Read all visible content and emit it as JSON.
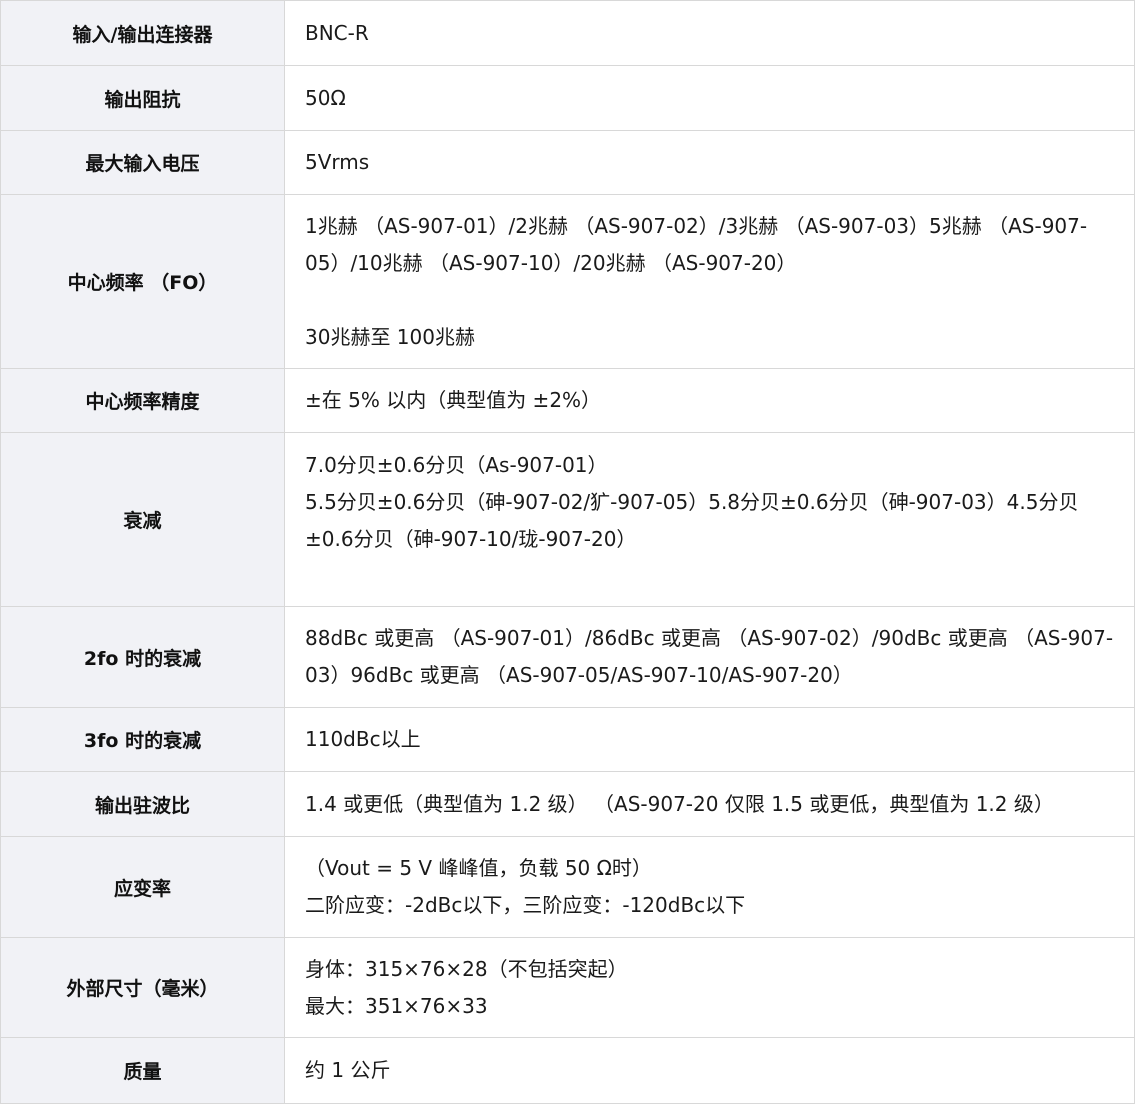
{
  "rows": [
    {
      "label": "输入/输出连接器",
      "lines": [
        "BNC-R"
      ]
    },
    {
      "label": "输出阻抗",
      "lines": [
        "50Ω"
      ]
    },
    {
      "label": "最大输入电压",
      "lines": [
        "5Vrms"
      ]
    },
    {
      "label": "中心频率 （FO）",
      "lines": [
        "1兆赫 （AS-907-01）/2兆赫 （AS-907-02）/3兆赫 （AS-907-03）5兆赫 （AS-907-05）/10兆赫 （AS-907-10）/20兆赫 （AS-907-20）",
        "",
        "30兆赫至 100兆赫"
      ]
    },
    {
      "label": "中心频率精度",
      "lines": [
        "±在 5% 以内（典型值为 ±2%）"
      ]
    },
    {
      "label": "衰减",
      "lines": [
        "7.0分贝±0.6分贝（As-907-01）",
        "5.5分贝±0.6分贝（砷-907-02/犷-907-05）5.8分贝±0.6分贝（砷-907-03）4.5分贝±0.6分贝（砷-907-10/珑-907-20）"
      ]
    },
    {
      "label": "2fo 时的衰减",
      "lines": [
        "88dBc 或更高 （AS-907-01）/86dBc 或更高 （AS-907-02）/90dBc 或更高 （AS-907-03）96dBc 或更高 （AS-907-05/AS-907-10/AS-907-20）"
      ]
    },
    {
      "label": "3fo 时的衰减",
      "lines": [
        "110dBc以上"
      ]
    },
    {
      "label": "输出驻波比",
      "lines": [
        "1.4 或更低（典型值为 1.2 级） （AS-907-20 仅限 1.5 或更低，典型值为 1.2 级）"
      ]
    },
    {
      "label": "应变率",
      "lines": [
        "（Vout = 5 V 峰峰值，负载 50 Ω时）",
        "二阶应变：-2dBc以下，三阶应变：-120dBc以下"
      ]
    },
    {
      "label": "外部尺寸（毫米）",
      "lines": [
        "身体：315×76×28（不包括突起）",
        "最大：351×76×33"
      ]
    },
    {
      "label": "质量",
      "lines": [
        "约 1 公斤"
      ]
    }
  ]
}
